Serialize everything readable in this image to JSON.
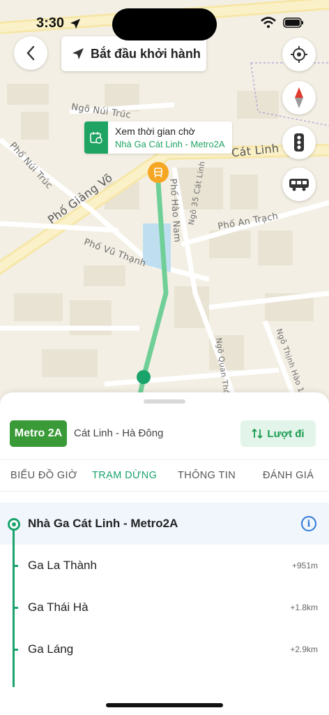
{
  "status_bar": {
    "time": "3:30"
  },
  "header": {
    "start_label": "Bắt đầu khởi hành"
  },
  "map": {
    "streets": [
      "Ngõ Núi Trúc",
      "Phố Núi Trúc",
      "Phố Giảng Võ",
      "Cát Linh",
      "Phố Hào Nam",
      "Ngõ 35 Cát Linh",
      "Phố An Trạch",
      "Phố Vũ Thạnh",
      "Ngõ Quan Thổ",
      "Ngõ Thịnh Hào 1"
    ],
    "wait_card": {
      "title": "Xem thời gian chờ",
      "subtitle": "Nhà Ga Cát Linh - Metro2A"
    }
  },
  "route": {
    "badge": "Metro 2A",
    "name": "Cát Linh - Hà Đông",
    "direction_label": "Lượt đi"
  },
  "tabs": [
    "BIỂU ĐỒ GIỜ",
    "TRẠM DỪNG",
    "THÔNG TIN",
    "ĐÁNH GIÁ"
  ],
  "stops": [
    {
      "name": "Nhà Ga Cát Linh - Metro2A",
      "distance": ""
    },
    {
      "name": "Ga La Thành",
      "distance": "+951m"
    },
    {
      "name": "Ga Thái Hà",
      "distance": "+1.8km"
    },
    {
      "name": "Ga Láng",
      "distance": "+2.9km"
    }
  ],
  "colors": {
    "accent": "#1aa36b",
    "badge": "#3a9a38",
    "route_line": "#6fcf97",
    "station_marker": "#f5a623"
  }
}
